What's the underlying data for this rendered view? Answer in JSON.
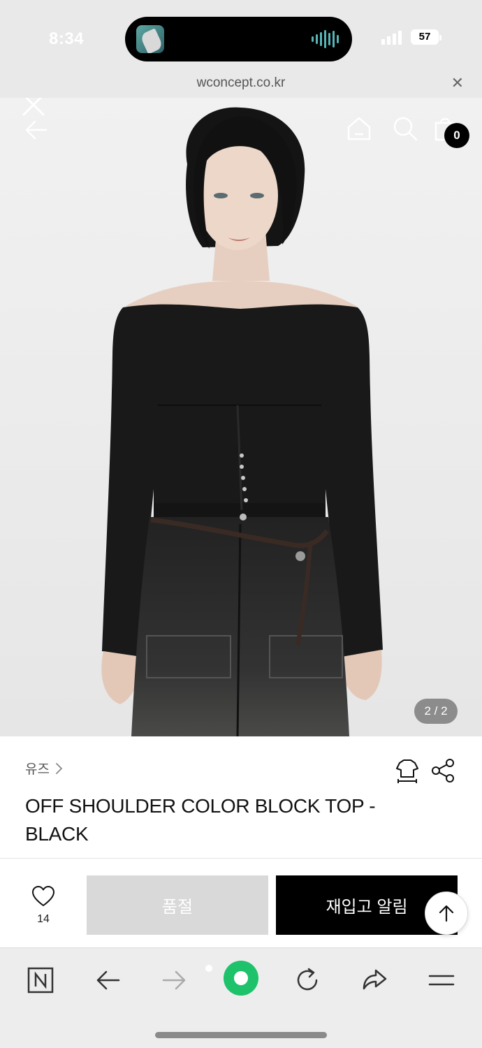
{
  "status_bar": {
    "time": "8:34",
    "battery": "57"
  },
  "url_bar": {
    "domain": "wconcept.co.kr"
  },
  "header": {
    "cart_count": "0"
  },
  "gallery": {
    "page_indicator": "2 / 2"
  },
  "product": {
    "brand": "유즈",
    "title_line1": "OFF SHOULDER COLOR BLOCK TOP -",
    "title_line2": "BLACK"
  },
  "actions": {
    "wish_count": "14",
    "soldout_label": "품절",
    "restock_label": "재입고 알림"
  },
  "icons": [
    "close-icon",
    "back-arrow-icon",
    "home-icon",
    "search-icon",
    "shopping-bag-icon",
    "chevron-right-icon",
    "size-guide-icon",
    "share-icon",
    "heart-icon",
    "arrow-up-icon",
    "naver-icon",
    "browser-back-icon",
    "browser-forward-icon",
    "green-dot-icon",
    "refresh-icon",
    "share-arrow-icon",
    "menu-icon"
  ]
}
